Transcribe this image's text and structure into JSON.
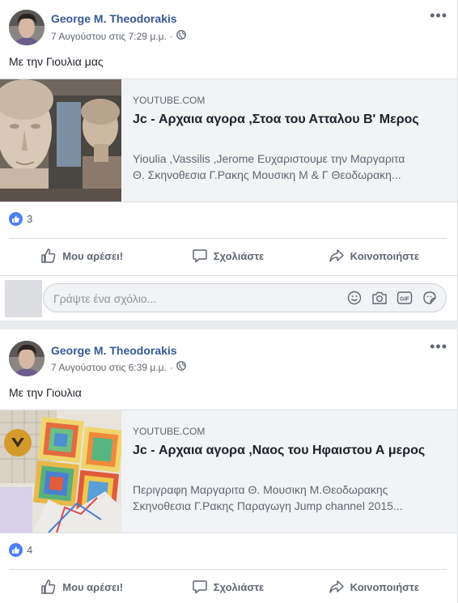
{
  "posts": [
    {
      "author": "George M. Theodorakis",
      "timestamp": "7 Αυγούστου στις 7:29 μ.μ.",
      "privacy_icon": "globe-icon",
      "text": "Με την Γιουλια μας",
      "link": {
        "source": "YOUTUBE.COM",
        "title": "Jc - Αρχαια αγορα ,Στοα του Ατταλου Β' Μερος",
        "description_line1": "Yioulia ,Vassilis ,Jerome Ευχαριστουμε την Μαργαριτα",
        "description_line2": "Θ. Σκηνοθεσια Γ.Ρακης Μουσικη Μ & Γ Θεοδωρακη..."
      },
      "reaction_count": "3",
      "actions": {
        "like": "Μου αρέσει!",
        "comment": "Σχολιάστε",
        "share": "Κοινοποιήστε"
      },
      "comment_placeholder": "Γράψτε ένα σχόλιο..."
    },
    {
      "author": "George M. Theodorakis",
      "timestamp": "7 Αυγούστου στις 6:39 μ.μ.",
      "privacy_icon": "globe-icon",
      "text": "Με την Γιουλια",
      "link": {
        "source": "YOUTUBE.COM",
        "title": "Jc - Αρχαια αγορα ,Ναος του Ηφαιστου Α μερος",
        "description_line1": "Περιγραφη Μαργαριτα Θ. Μουσικη Μ.Θεοδωρακης",
        "description_line2": "Σκηνοθεσια Γ.Ρακης Παραγωγη Jump channel 2015..."
      },
      "reaction_count": "4",
      "actions": {
        "like": "Μου αρέσει!",
        "comment": "Σχολιάστε",
        "share": "Κοινοποιήστε"
      }
    }
  ],
  "colors": {
    "author": "#365899",
    "like_badge": "#4c7ef4",
    "page_bg": "#e9ebee"
  }
}
